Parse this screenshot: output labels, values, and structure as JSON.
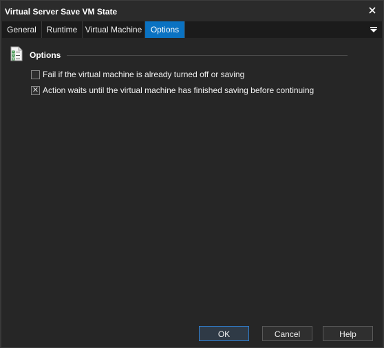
{
  "window": {
    "title": "Virtual Server Save VM State",
    "close_icon": "close-icon"
  },
  "tabs": [
    {
      "label": "General",
      "active": false
    },
    {
      "label": "Runtime",
      "active": false
    },
    {
      "label": "Virtual Machine",
      "active": false
    },
    {
      "label": "Options",
      "active": true
    }
  ],
  "tab_menu_icon": "dropdown-menu-icon",
  "section": {
    "title": "Options",
    "icon": "checklist-icon"
  },
  "options": [
    {
      "label": "Fail if the virtual machine is already turned off or saving",
      "checked": false
    },
    {
      "label": "Action waits until the virtual machine has finished saving before continuing",
      "checked": true
    }
  ],
  "buttons": {
    "ok": "OK",
    "cancel": "Cancel",
    "help": "Help"
  },
  "colors": {
    "accent": "#0a72c2",
    "background": "#262626"
  }
}
